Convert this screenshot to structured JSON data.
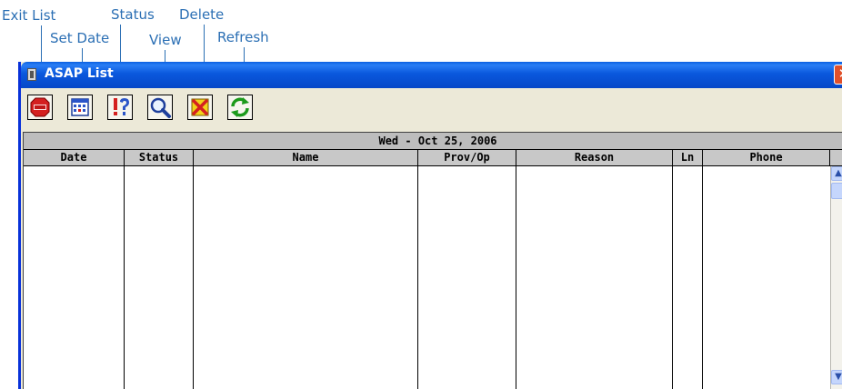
{
  "callouts": {
    "exit_list": "Exit List",
    "set_date": "Set Date",
    "status": "Status",
    "view": "View",
    "delete": "Delete",
    "refresh": "Refresh"
  },
  "window": {
    "title": "ASAP List",
    "close_glyph": "✕"
  },
  "toolbar": {
    "buttons": [
      {
        "name": "exit-list-button",
        "icon": "exit-icon"
      },
      {
        "name": "set-date-button",
        "icon": "calendar-icon"
      },
      {
        "name": "status-button",
        "icon": "status-icon"
      },
      {
        "name": "view-button",
        "icon": "magnifier-icon"
      },
      {
        "name": "delete-button",
        "icon": "delete-icon"
      },
      {
        "name": "refresh-button",
        "icon": "refresh-icon"
      }
    ]
  },
  "list": {
    "date_banner": "Wed - Oct 25, 2006",
    "columns": [
      "Date",
      "Status",
      "Name",
      "Prov/Op",
      "Reason",
      "Ln",
      "Phone"
    ],
    "rows": []
  },
  "scrollbar": {
    "up": "▲",
    "down": "▼"
  },
  "colors": {
    "callout_blue": "#2b6fb4",
    "titlebar_blue": "#0a58dd",
    "window_face": "#ece9d8",
    "close_red": "#e0502a"
  }
}
